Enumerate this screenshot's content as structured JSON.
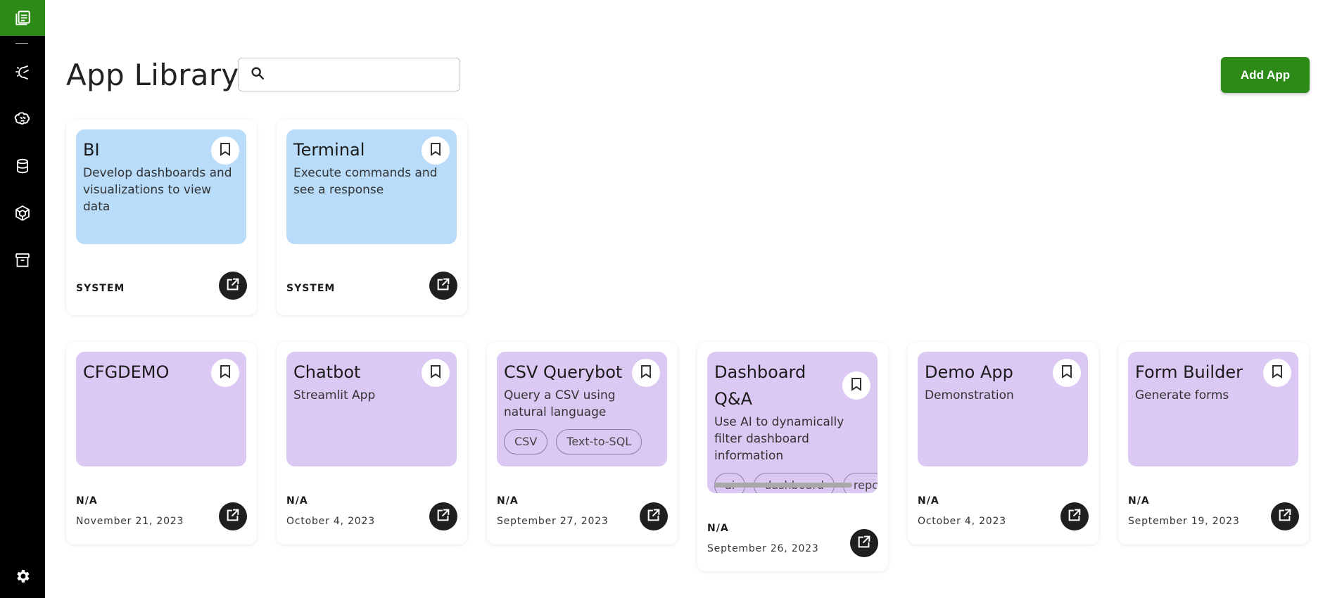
{
  "sidebar": {
    "logo_icon": "app-library-icon",
    "items": [
      {
        "name": "prompt-icon"
      },
      {
        "name": "model-icon"
      },
      {
        "name": "database-icon"
      },
      {
        "name": "catalog-icon"
      },
      {
        "name": "storage-icon"
      }
    ],
    "settings_icon": "gear-icon"
  },
  "header": {
    "title": "App Library",
    "search_placeholder": "",
    "add_button_label": "Add App"
  },
  "system_apps": [
    {
      "name": "BI",
      "description": "Develop dashboards and visualizations to view data",
      "owner": "SYSTEM"
    },
    {
      "name": "Terminal",
      "description": "Execute commands and see a response",
      "owner": "SYSTEM"
    }
  ],
  "apps": [
    {
      "name": "CFGDEMO",
      "description": "",
      "tags": [],
      "owner": "N/A",
      "date": "November 21, 2023"
    },
    {
      "name": "Chatbot",
      "description": "Streamlit App",
      "tags": [],
      "owner": "N/A",
      "date": "October 4, 2023"
    },
    {
      "name": "CSV Querybot",
      "description": "Query a CSV using natural language",
      "tags": [
        "CSV",
        "Text-to-SQL"
      ],
      "owner": "N/A",
      "date": "September 27, 2023"
    },
    {
      "name": "Dashboard Q&A",
      "description": "Use AI to dynamically filter dashboard information",
      "tags": [
        "ai",
        "dashboard",
        "repc"
      ],
      "owner": "N/A",
      "date": "September 26, 2023"
    },
    {
      "name": "Demo App",
      "description": "Demonstration",
      "tags": [],
      "owner": "N/A",
      "date": "October 4, 2023"
    },
    {
      "name": "Form Builder",
      "description": "Generate forms",
      "tags": [],
      "owner": "N/A",
      "date": "September 19, 2023"
    }
  ],
  "colors": {
    "brand_green": "#2c8a17",
    "system_card": "#b9dcfb",
    "user_card": "#dbc9f4"
  }
}
